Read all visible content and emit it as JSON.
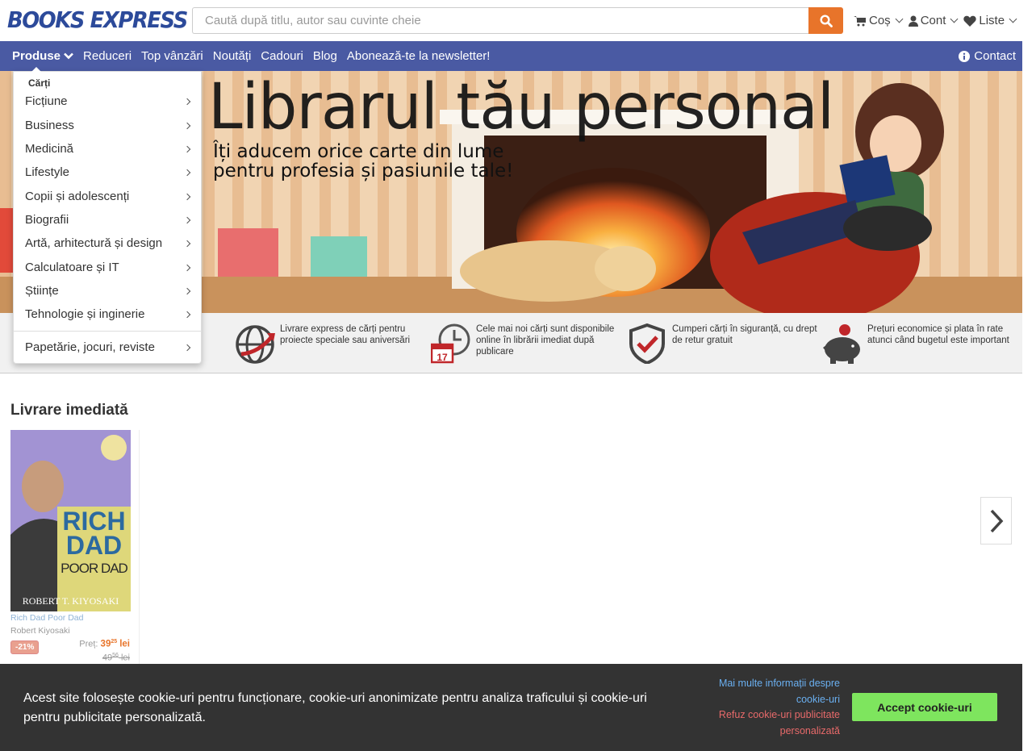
{
  "header": {
    "logo": "BOOKS EXPRESS",
    "search_placeholder": "Caută după titlu, autor sau cuvinte cheie",
    "cart_label": "Coș",
    "account_label": "Cont",
    "lists_label": "Liste"
  },
  "nav": {
    "products": "Produse",
    "items": [
      "Reduceri",
      "Top vânzări",
      "Noutăți",
      "Cadouri",
      "Blog",
      "Abonează-te la newsletter!"
    ],
    "contact": "Contact"
  },
  "hero": {
    "title": "Librarul tău personal",
    "subtitle_line1": "Îți aducem orice carte din lume",
    "subtitle_line2": "pentru profesia și pasiunile tale!"
  },
  "menu": {
    "heading": "Cărți",
    "items": [
      "Ficțiune",
      "Business",
      "Medicină",
      "Lifestyle",
      "Copii și adolescenți",
      "Biografii",
      "Artă, arhitectură și design",
      "Calculatoare și IT",
      "Științe",
      "Tehnologie și inginerie"
    ],
    "extra": "Papetărie, jocuri, reviste"
  },
  "features": [
    {
      "icon": "globe-delivery-icon",
      "text": "Livrare express de cărți pentru proiecte speciale sau aniversări"
    },
    {
      "icon": "clock-calendar-icon",
      "text": "Cele mai noi cărți sunt disponibile online în librării imediat după publicare"
    },
    {
      "icon": "shield-check-icon",
      "text": "Cumperi cărți în siguranță, cu drept de retur gratuit"
    },
    {
      "icon": "piggy-bank-icon",
      "text": "Prețuri economice și plata în rate atunci când bugetul este important"
    }
  ],
  "section": {
    "title": "Livrare imediată"
  },
  "book": {
    "cover_title": "RICH DAD",
    "cover_subtitle": "POOR DAD",
    "cover_author": "ROBERT T. KIYOSAKI",
    "title": "Rich Dad Poor Dad",
    "author": "Robert Kiyosaki",
    "discount": "-21%",
    "price_label": "Preț:",
    "price_int": "39",
    "price_dec": "25",
    "currency": "lei",
    "old_int": "49",
    "old_dec": "56",
    "old_currency": "lei"
  },
  "cookie": {
    "text": "Acest site folosește cookie-uri pentru funcționare, cookie-uri anonimizate pentru analiza traficului și cookie-uri pentru publicitate personalizată.",
    "more": "Mai multe informații despre cookie-uri",
    "refuse": "Refuz cookie-uri publicitate personalizată",
    "accept": "Accept cookie-uri"
  },
  "colors": {
    "nav_bg": "#4a5aa3",
    "accent": "#e8742a",
    "logo": "#2c4a9a",
    "accept_btn": "#7ee55e"
  }
}
